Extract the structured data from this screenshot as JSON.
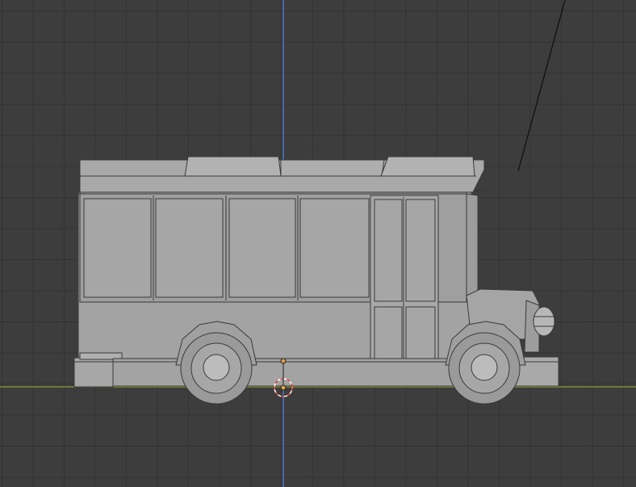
{
  "app": {
    "name": "",
    "view": "",
    "mode": ""
  },
  "viewport": {
    "background": "#3d3d3d",
    "grid_color": "#333333",
    "axis_colors": {
      "z_axis": "#4b78c8",
      "x_axis": "#8f9a3a"
    }
  },
  "scene": {
    "objects": [
      {
        "name": "",
        "type": "mesh",
        "shape": "bus",
        "color": "#a6a6a6"
      },
      {
        "name": "",
        "type": "empty",
        "shape": "3d-cursor",
        "color": "#d8342b"
      },
      {
        "name": "",
        "type": "camera-line",
        "shape": "line",
        "color": "#111111"
      }
    ]
  }
}
